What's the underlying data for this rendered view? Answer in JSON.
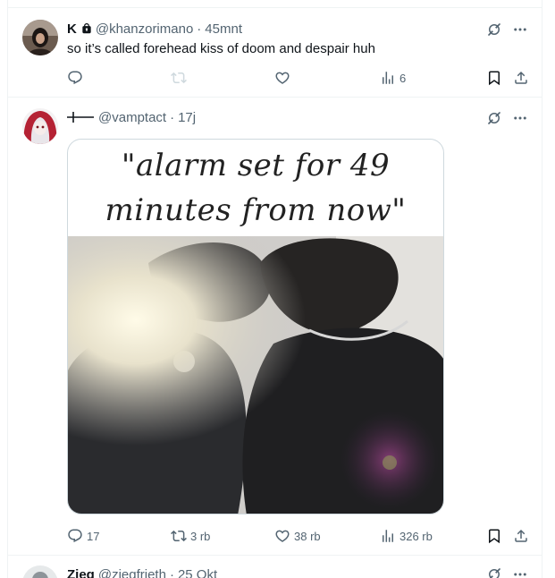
{
  "tweets": [
    {
      "name": "K",
      "handle": "@khanzorimano",
      "separator": "·",
      "time": "45mnt",
      "text": "so it’s called forehead kiss of doom and despair huh",
      "reply_count": "",
      "retweet_count": "",
      "like_count": "",
      "views_count": "6",
      "locked": true
    },
    {
      "name": "",
      "handle": "@vamptact",
      "separator": "·",
      "time": "17j",
      "media_caption_line1": "\"alarm set for 49",
      "media_caption_line2": "minutes from now\"",
      "reply_count": "17",
      "retweet_count": "3 rb",
      "like_count": "38 rb",
      "views_count": "326 rb"
    },
    {
      "name": "Zieg",
      "handle": "@ziegfrieth",
      "separator": "·",
      "time": "25 Okt"
    }
  ],
  "icons": {
    "reply": "reply-icon",
    "retweet": "retweet-icon",
    "like": "like-icon",
    "views": "views-icon",
    "bookmark": "bookmark-icon",
    "share": "share-icon",
    "grok": "grok-icon",
    "more": "more-icon",
    "lock": "lock-icon"
  },
  "colors": {
    "text": "#0f1419",
    "secondary": "#536471",
    "border": "#eff3f4"
  }
}
